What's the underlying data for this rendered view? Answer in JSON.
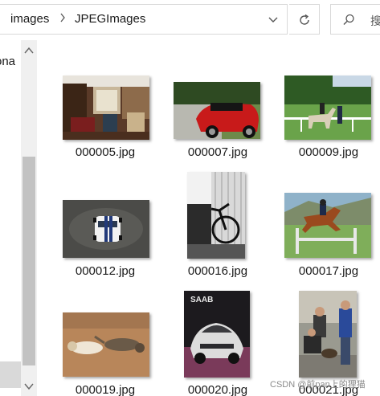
{
  "breadcrumb": {
    "items": [
      "images",
      "JPEGImages"
    ],
    "separator": ">"
  },
  "search": {
    "placeholder": "搜"
  },
  "nav": {
    "partial_label": "ona"
  },
  "files": [
    {
      "name": "000005.jpg"
    },
    {
      "name": "000007.jpg"
    },
    {
      "name": "000009.jpg"
    },
    {
      "name": "000012.jpg"
    },
    {
      "name": "000016.jpg"
    },
    {
      "name": "000017.jpg"
    },
    {
      "name": "000019.jpg"
    },
    {
      "name": "000020.jpg"
    },
    {
      "name": "000021.jpg"
    }
  ],
  "watermark": "CSDN @前pan上的狸猫",
  "colors": {
    "border": "#d9d9d9",
    "scroll_track": "#f0f0f0",
    "scroll_thumb": "#c2c2c2"
  }
}
